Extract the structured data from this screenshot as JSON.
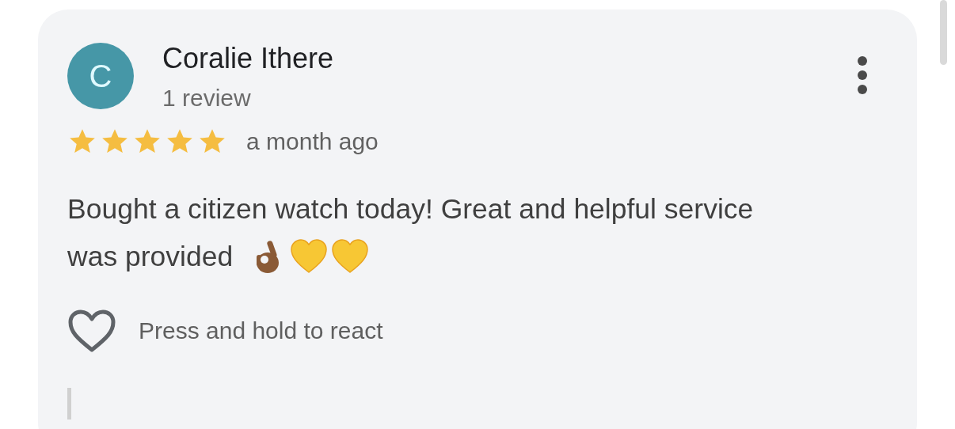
{
  "review": {
    "avatar_letter": "C",
    "author": "Coralie Ithere",
    "author_meta": "1 review",
    "stars": 5,
    "time": "a month ago",
    "text_lines": [
      "Bought a citizen watch today! Great and helpful service",
      "was provided"
    ],
    "react_hint": "Press and hold to react"
  }
}
